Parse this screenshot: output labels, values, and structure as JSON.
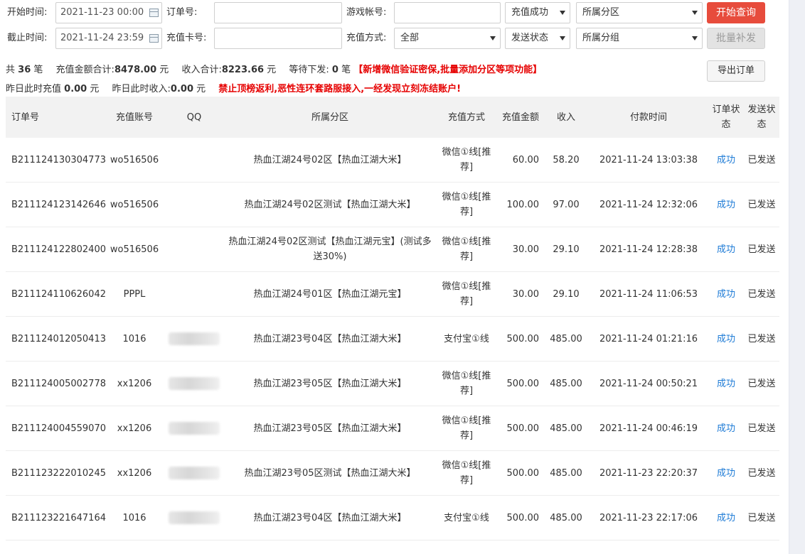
{
  "filters": {
    "start_time_label": "开始时间:",
    "start_time_value": "2021-11-23 00:00",
    "end_time_label": "截止时间:",
    "end_time_value": "2021-11-24 23:59",
    "order_no_label": "订单号:",
    "order_no_value": "",
    "card_no_label": "充值卡号:",
    "card_no_value": "",
    "game_account_label": "游戏帐号:",
    "game_account_value": "",
    "pay_method_label": "充值方式:",
    "pay_method_value": "全部",
    "recharge_status_value": "充值成功",
    "send_status_value": "发送状态",
    "zone_value": "所属分区",
    "group_value": "所属分组",
    "query_button": "开始查询",
    "batch_button": "批量补发",
    "export_button": "导出订单"
  },
  "summary": {
    "total_prefix": "共",
    "total_count": "36",
    "total_unit": "笔",
    "amount_label": "充值金额合计:",
    "amount_value": "8478.00",
    "amount_unit": "元",
    "income_label": "收入合计:",
    "income_value": "8223.66",
    "income_unit": "元",
    "pending_label": "等待下发:",
    "pending_value": "0",
    "pending_unit": "笔",
    "notice1": "【新增微信验证密保,批量添加分区等项功能】",
    "yesterday_recharge_label": "昨日此时充值",
    "yesterday_recharge_value": "0.00",
    "yesterday_recharge_unit": "元",
    "yesterday_income_label": "昨日此时收入:",
    "yesterday_income_value": "0.00",
    "yesterday_income_unit": "元",
    "notice2": "禁止顶榜返利,恶性连环套路服接入,一经发现立刻冻结账户!"
  },
  "table": {
    "headers": [
      "订单号",
      "充值账号",
      "QQ",
      "所属分区",
      "充值方式",
      "充值金额",
      "收入",
      "付款时间",
      "订单状态",
      "发送状态"
    ],
    "rows": [
      {
        "order": "B211124130304773",
        "account": "wo516506",
        "qq": "",
        "zone": "热血江湖24号02区【热血江湖大米】",
        "method": "微信①线[推荐]",
        "amount": "60.00",
        "income": "58.20",
        "time": "2021-11-24 13:03:38",
        "status": "成功",
        "send": "已发送"
      },
      {
        "order": "B211124123142646",
        "account": "wo516506",
        "qq": "",
        "zone": "热血江湖24号02区测试【热血江湖大米】",
        "method": "微信①线[推荐]",
        "amount": "100.00",
        "income": "97.00",
        "time": "2021-11-24 12:32:06",
        "status": "成功",
        "send": "已发送"
      },
      {
        "order": "B211124122802400",
        "account": "wo516506",
        "qq": "",
        "zone": "热血江湖24号02区测试【热血江湖元宝】(测试多送30%)",
        "method": "微信①线[推荐]",
        "amount": "30.00",
        "income": "29.10",
        "time": "2021-11-24 12:28:38",
        "status": "成功",
        "send": "已发送"
      },
      {
        "order": "B211124110626042",
        "account": "PPPL",
        "qq": "",
        "zone": "热血江湖24号01区【热血江湖元宝】",
        "method": "微信①线[推荐]",
        "amount": "30.00",
        "income": "29.10",
        "time": "2021-11-24 11:06:53",
        "status": "成功",
        "send": "已发送"
      },
      {
        "order": "B211124012050413",
        "account": "1016",
        "qq": "blurred",
        "zone": "热血江湖23号04区【热血江湖大米】",
        "method": "支付宝①线",
        "amount": "500.00",
        "income": "485.00",
        "time": "2021-11-24 01:21:16",
        "status": "成功",
        "send": "已发送"
      },
      {
        "order": "B211124005002778",
        "account": "xx1206",
        "qq": "blurred",
        "zone": "热血江湖23号05区【热血江湖大米】",
        "method": "微信①线[推荐]",
        "amount": "500.00",
        "income": "485.00",
        "time": "2021-11-24 00:50:21",
        "status": "成功",
        "send": "已发送"
      },
      {
        "order": "B211124004559070",
        "account": "xx1206",
        "qq": "blurred",
        "zone": "热血江湖23号05区【热血江湖大米】",
        "method": "微信①线[推荐]",
        "amount": "500.00",
        "income": "485.00",
        "time": "2021-11-24 00:46:19",
        "status": "成功",
        "send": "已发送"
      },
      {
        "order": "B211123222010245",
        "account": "xx1206",
        "qq": "blurred",
        "zone": "热血江湖23号05区测试【热血江湖大米】",
        "method": "微信①线[推荐]",
        "amount": "500.00",
        "income": "485.00",
        "time": "2021-11-23 22:20:37",
        "status": "成功",
        "send": "已发送"
      },
      {
        "order": "B211123221647164",
        "account": "1016",
        "qq": "blurred",
        "zone": "热血江湖23号04区【热血江湖大米】",
        "method": "支付宝①线",
        "amount": "500.00",
        "income": "485.00",
        "time": "2021-11-23 22:17:06",
        "status": "成功",
        "send": "已发送"
      }
    ]
  }
}
